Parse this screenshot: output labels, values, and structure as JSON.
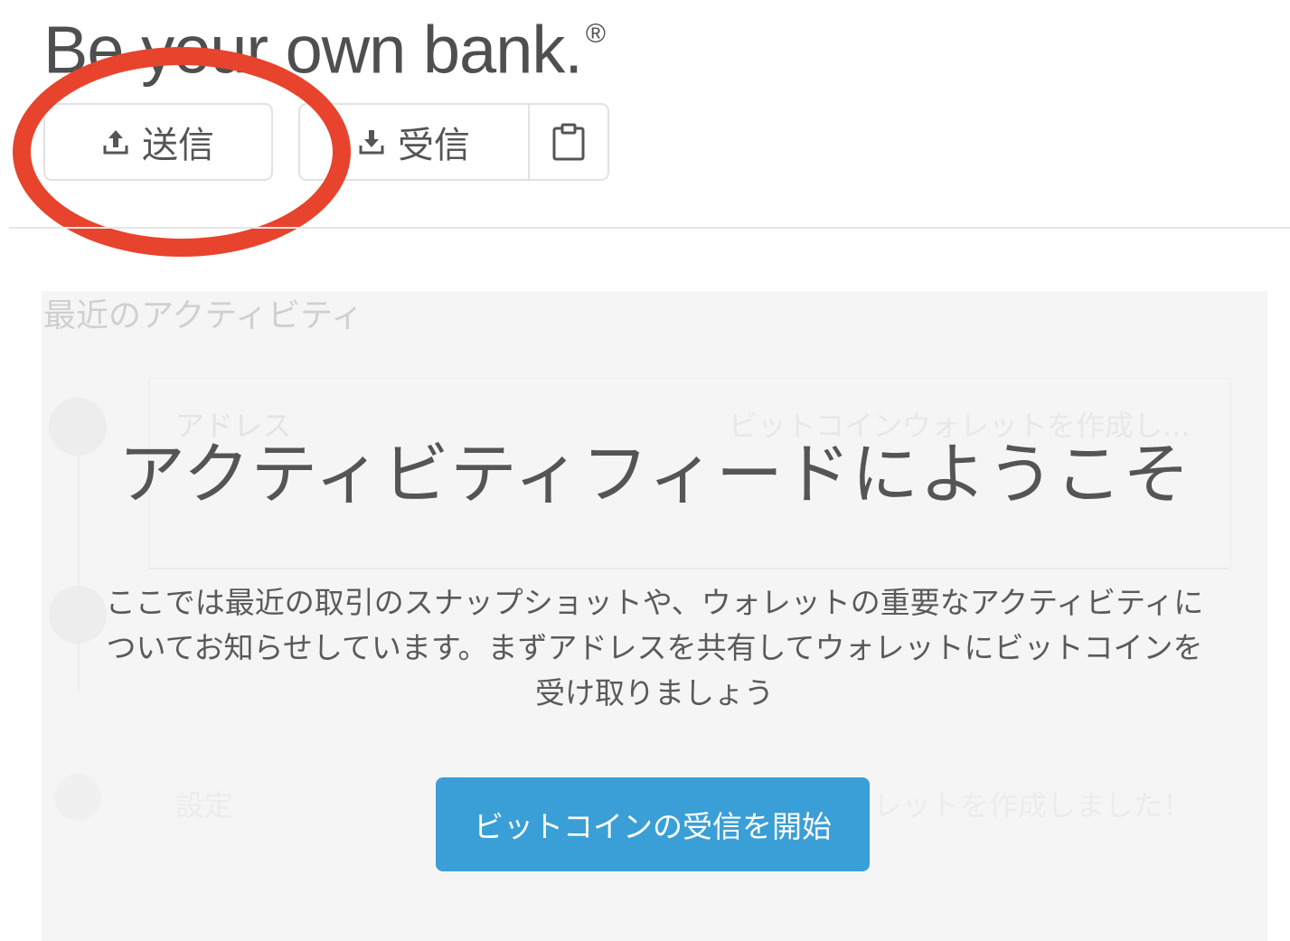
{
  "header": {
    "headline": "Be your own bank.",
    "registered_mark": "®"
  },
  "actions": {
    "send": {
      "label": "送信",
      "icon": "upload-arrow-icon"
    },
    "receive": {
      "label": "受信",
      "icon": "download-arrow-icon"
    },
    "copy": {
      "icon": "clipboard-icon"
    }
  },
  "annotation": {
    "color": "#e8432d"
  },
  "activity": {
    "section_title": "最近のアクティビティ",
    "background_rows": [
      {
        "label": "アドレス",
        "detail": "ビットコインウォレットを作成し..."
      },
      {
        "label": "設定",
        "detail": ""
      },
      {
        "label": "設定",
        "detail": "レットを作成しました！"
      }
    ],
    "welcome_title": "アクティビティフィードにようこそ",
    "welcome_text": "ここでは最近の取引のスナップショットや、ウォレットの重要なアクティビティについてお知らせしています。まずアドレスを共有してウォレットにビットコインを受け取りましょう",
    "cta_label": "ビットコインの受信を開始"
  },
  "colors": {
    "accent": "#3a9fd6",
    "text": "#555555",
    "panel_bg": "#f5f5f5"
  }
}
